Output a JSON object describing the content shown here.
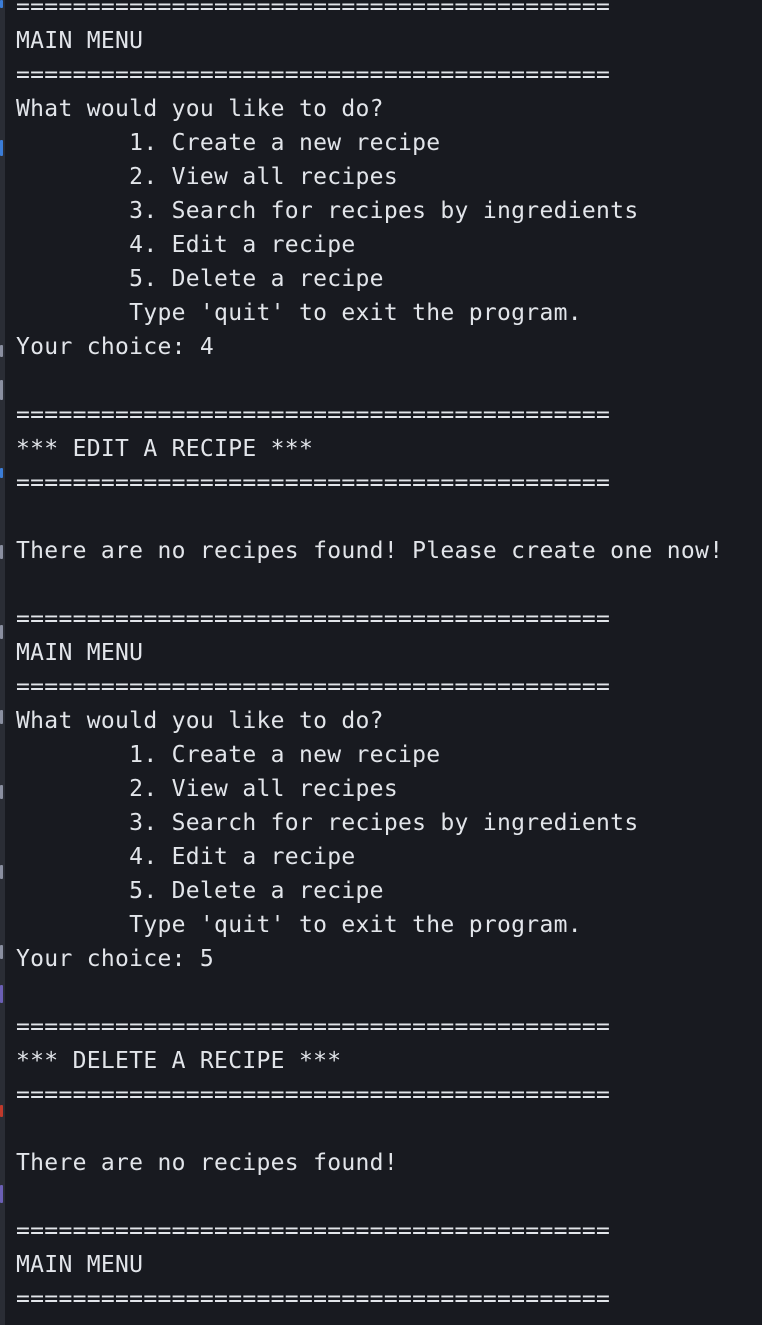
{
  "terminal": {
    "lines": [
      "==========================================",
      "MAIN MENU",
      "==========================================",
      "What would you like to do?",
      "        1. Create a new recipe",
      "        2. View all recipes",
      "        3. Search for recipes by ingredients",
      "        4. Edit a recipe",
      "        5. Delete a recipe",
      "        Type 'quit' to exit the program.",
      "Your choice: 4",
      "",
      "==========================================",
      "*** EDIT A RECIPE ***",
      "==========================================",
      "",
      "There are no recipes found! Please create one now!",
      "",
      "==========================================",
      "MAIN MENU",
      "==========================================",
      "What would you like to do?",
      "        1. Create a new recipe",
      "        2. View all recipes",
      "        3. Search for recipes by ingredients",
      "        4. Edit a recipe",
      "        5. Delete a recipe",
      "        Type 'quit' to exit the program.",
      "Your choice: 5",
      "",
      "==========================================",
      "*** DELETE A RECIPE ***",
      "==========================================",
      "",
      "There are no recipes found!",
      "",
      "==========================================",
      "MAIN MENU",
      "=========================================="
    ]
  },
  "colors": {
    "background": "#181a20",
    "text": "#e2e5ea",
    "gutter": "#2a2d35",
    "accent_blue": "#3b7dd8"
  }
}
